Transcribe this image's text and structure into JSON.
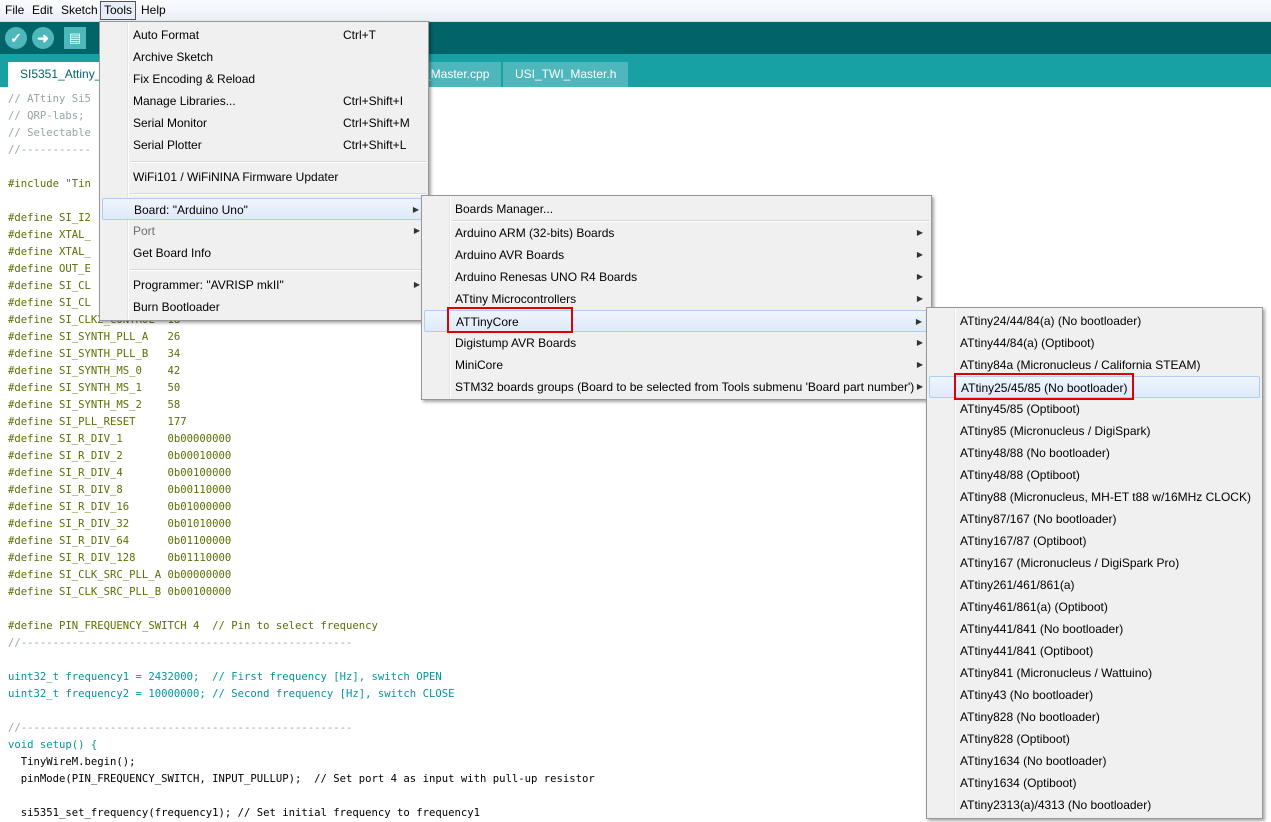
{
  "menubar": {
    "file": "File",
    "edit": "Edit",
    "sketch": "Sketch",
    "tools": "Tools",
    "help": "Help"
  },
  "tabs": [
    "SI5351_Attiny_",
    "_Master.cpp",
    "USI_TWI_Master.h"
  ],
  "code": [
    {
      "text": "// ATtiny Si5",
      "style": "cmt"
    },
    {
      "text": "// QRP-labs;",
      "style": "cmt"
    },
    {
      "text": "// Selectable",
      "style": "cmt"
    },
    {
      "text": "//-----------",
      "style": "cmt"
    },
    {
      "text": "",
      "style": "cmt"
    },
    {
      "text": "#include \"Tin",
      "style": "pre"
    },
    {
      "text": "",
      "style": "cmt"
    },
    {
      "text": "#define SI_I2",
      "style": "def"
    },
    {
      "text": "#define XTAL_",
      "style": "def"
    },
    {
      "text": "#define XTAL_",
      "style": "def"
    },
    {
      "text": "#define OUT_E",
      "style": "def"
    },
    {
      "text": "#define SI_CL",
      "style": "def"
    },
    {
      "text": "#define SI_CL",
      "style": "def"
    },
    {
      "text": "#define SI_CLK2_CONTROL  18",
      "style": "def"
    },
    {
      "text": "#define SI_SYNTH_PLL_A   26",
      "style": "def"
    },
    {
      "text": "#define SI_SYNTH_PLL_B   34",
      "style": "def"
    },
    {
      "text": "#define SI_SYNTH_MS_0    42",
      "style": "def"
    },
    {
      "text": "#define SI_SYNTH_MS_1    50",
      "style": "def"
    },
    {
      "text": "#define SI_SYNTH_MS_2    58",
      "style": "def"
    },
    {
      "text": "#define SI_PLL_RESET     177",
      "style": "def"
    },
    {
      "text": "#define SI_R_DIV_1       0b00000000",
      "style": "def"
    },
    {
      "text": "#define SI_R_DIV_2       0b00010000",
      "style": "def"
    },
    {
      "text": "#define SI_R_DIV_4       0b00100000",
      "style": "def"
    },
    {
      "text": "#define SI_R_DIV_8       0b00110000",
      "style": "def"
    },
    {
      "text": "#define SI_R_DIV_16      0b01000000",
      "style": "def"
    },
    {
      "text": "#define SI_R_DIV_32      0b01010000",
      "style": "def"
    },
    {
      "text": "#define SI_R_DIV_64      0b01100000",
      "style": "def"
    },
    {
      "text": "#define SI_R_DIV_128     0b01110000",
      "style": "def"
    },
    {
      "text": "#define SI_CLK_SRC_PLL_A 0b00000000",
      "style": "def"
    },
    {
      "text": "#define SI_CLK_SRC_PLL_B 0b00100000",
      "style": "def"
    },
    {
      "text": "",
      "style": "cmt"
    },
    {
      "text": "#define PIN_FREQUENCY_SWITCH 4  // Pin to select frequency",
      "style": "def"
    },
    {
      "text": "//----------------------------------------------------",
      "style": "cmt"
    },
    {
      "text": "",
      "style": "cmt"
    },
    {
      "text": "uint32_t frequency1 = 2432000;  // First frequency [Hz], switch OPEN",
      "style": "type"
    },
    {
      "text": "uint32_t frequency2 = 10000000; // Second frequency [Hz], switch CLOSE",
      "style": "type"
    },
    {
      "text": "",
      "style": "cmt"
    },
    {
      "text": "//----------------------------------------------------",
      "style": "cmt"
    },
    {
      "text": "void setup() {",
      "style": "type"
    },
    {
      "text": "  TinyWireM.begin();",
      "style": "plain"
    },
    {
      "text": "  pinMode(PIN_FREQUENCY_SWITCH, INPUT_PULLUP);  // Set port 4 as input with pull-up resistor",
      "style": "plain"
    },
    {
      "text": "",
      "style": "cmt"
    },
    {
      "text": "  si5351_set_frequency(frequency1); // Set initial frequency to frequency1",
      "style": "plain"
    }
  ],
  "tools_menu": {
    "auto_format": "Auto Format",
    "auto_format_sc": "Ctrl+T",
    "archive": "Archive Sketch",
    "fix_encoding": "Fix Encoding & Reload",
    "manage_libs": "Manage Libraries...",
    "manage_libs_sc": "Ctrl+Shift+I",
    "serial_monitor": "Serial Monitor",
    "serial_monitor_sc": "Ctrl+Shift+M",
    "serial_plotter": "Serial Plotter",
    "serial_plotter_sc": "Ctrl+Shift+L",
    "wifi": "WiFi101 / WiFiNINA Firmware Updater",
    "board": "Board: \"Arduino Uno\"",
    "port": "Port",
    "board_info": "Get Board Info",
    "programmer": "Programmer: \"AVRISP mkII\"",
    "burn": "Burn Bootloader"
  },
  "board_menu": [
    "Boards Manager...",
    "Arduino ARM (32-bits) Boards",
    "Arduino AVR Boards",
    "Arduino Renesas UNO R4 Boards",
    "ATtiny Microcontrollers",
    "ATTinyCore",
    "Digistump AVR Boards",
    "MiniCore",
    "STM32 boards groups (Board to be selected from Tools submenu 'Board part number')"
  ],
  "attinycore_menu": [
    "ATtiny24/44/84(a) (No bootloader)",
    "ATtiny44/84(a) (Optiboot)",
    "ATtiny84a (Micronucleus / California STEAM)",
    "ATtiny25/45/85 (No bootloader)",
    "ATtiny45/85 (Optiboot)",
    "ATtiny85 (Micronucleus / DigiSpark)",
    "ATtiny48/88 (No bootloader)",
    "ATtiny48/88 (Optiboot)",
    "ATtiny88 (Micronucleus, MH-ET t88 w/16MHz CLOCK)",
    "ATtiny87/167 (No bootloader)",
    "ATtiny167/87 (Optiboot)",
    "ATtiny167 (Micronucleus / DigiSpark Pro)",
    "ATtiny261/461/861(a)",
    "ATtiny461/861(a) (Optiboot)",
    "ATtiny441/841 (No bootloader)",
    "ATtiny441/841 (Optiboot)",
    "ATtiny841 (Micronucleus / Wattuino)",
    "ATtiny43 (No bootloader)",
    "ATtiny828 (No bootloader)",
    "ATtiny828 (Optiboot)",
    "ATtiny1634 (No bootloader)",
    "ATtiny1634 (Optiboot)",
    "ATtiny2313(a)/4313 (No bootloader)"
  ],
  "colors": {
    "toolbar": "#006468",
    "tabbar": "#17a1a5",
    "highlight_box": "#e00000"
  }
}
